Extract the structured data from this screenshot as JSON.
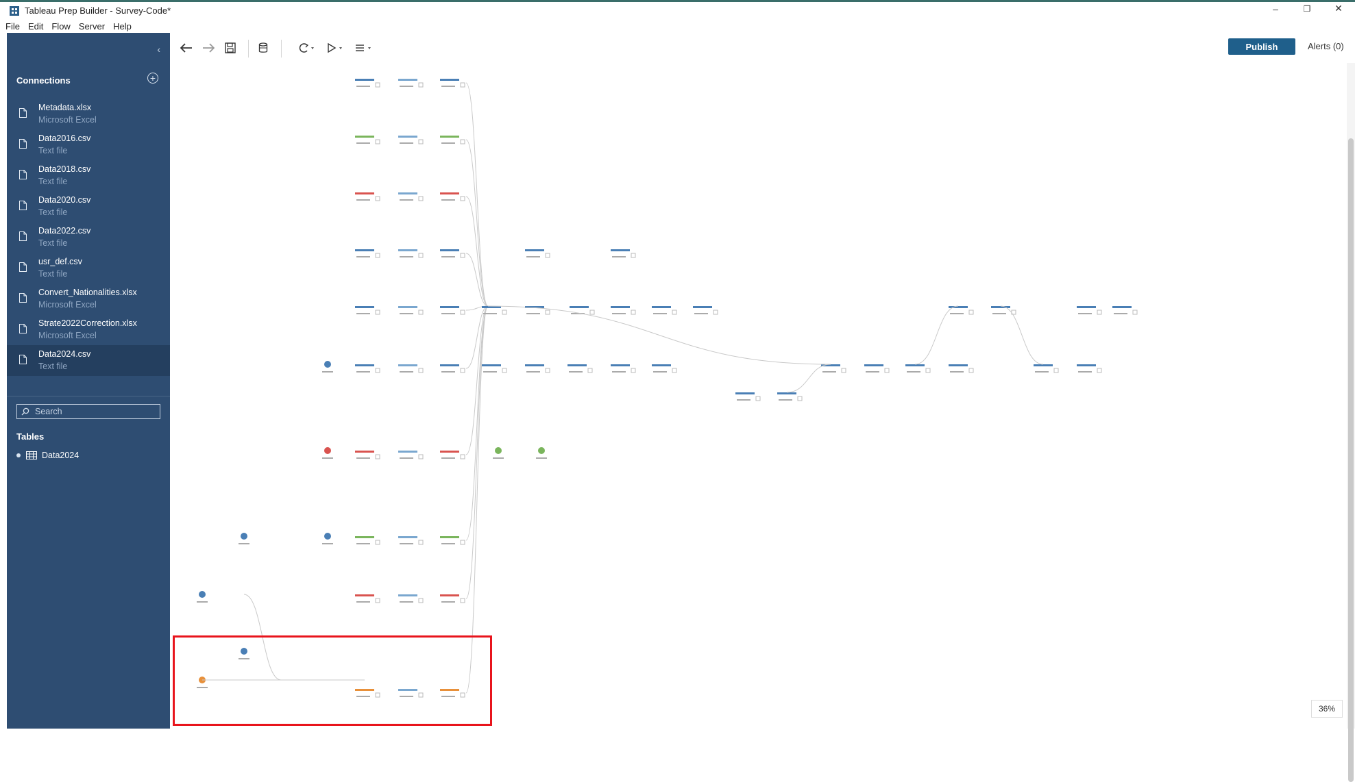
{
  "window": {
    "title": "Tableau Prep Builder - Survey-Code*",
    "controls": [
      "–",
      "❐",
      "✕"
    ]
  },
  "menu": [
    "File",
    "Edit",
    "Flow",
    "Server",
    "Help"
  ],
  "sidebar": {
    "connections_label": "Connections",
    "connections": [
      {
        "name": "Metadata.xlsx",
        "type": "Microsoft Excel"
      },
      {
        "name": "Data2016.csv",
        "type": "Text file"
      },
      {
        "name": "Data2018.csv",
        "type": "Text file"
      },
      {
        "name": "Data2020.csv",
        "type": "Text file"
      },
      {
        "name": "Data2022.csv",
        "type": "Text file"
      },
      {
        "name": "usr_def.csv",
        "type": "Text file"
      },
      {
        "name": "Convert_Nationalities.xlsx",
        "type": "Microsoft Excel"
      },
      {
        "name": "Strate2022Correction.xlsx",
        "type": "Microsoft Excel"
      },
      {
        "name": "Data2024.csv",
        "type": "Text file"
      }
    ],
    "selected_connection": "Data2024.csv",
    "search_placeholder": "Search",
    "tables_label": "Tables",
    "tables": [
      "Data2024"
    ]
  },
  "toolbar": {
    "publish_label": "Publish",
    "alerts_label": "Alerts (0)"
  },
  "canvas": {
    "zoom": "36%",
    "colors": {
      "blue": "#4a7fb5",
      "green": "#7ab55c",
      "red": "#d9534f",
      "orange": "#e8903a",
      "teal": "#4aa3a3",
      "purple": "#8e5a9e",
      "highlight": "#e8141c"
    },
    "note": ""
  }
}
